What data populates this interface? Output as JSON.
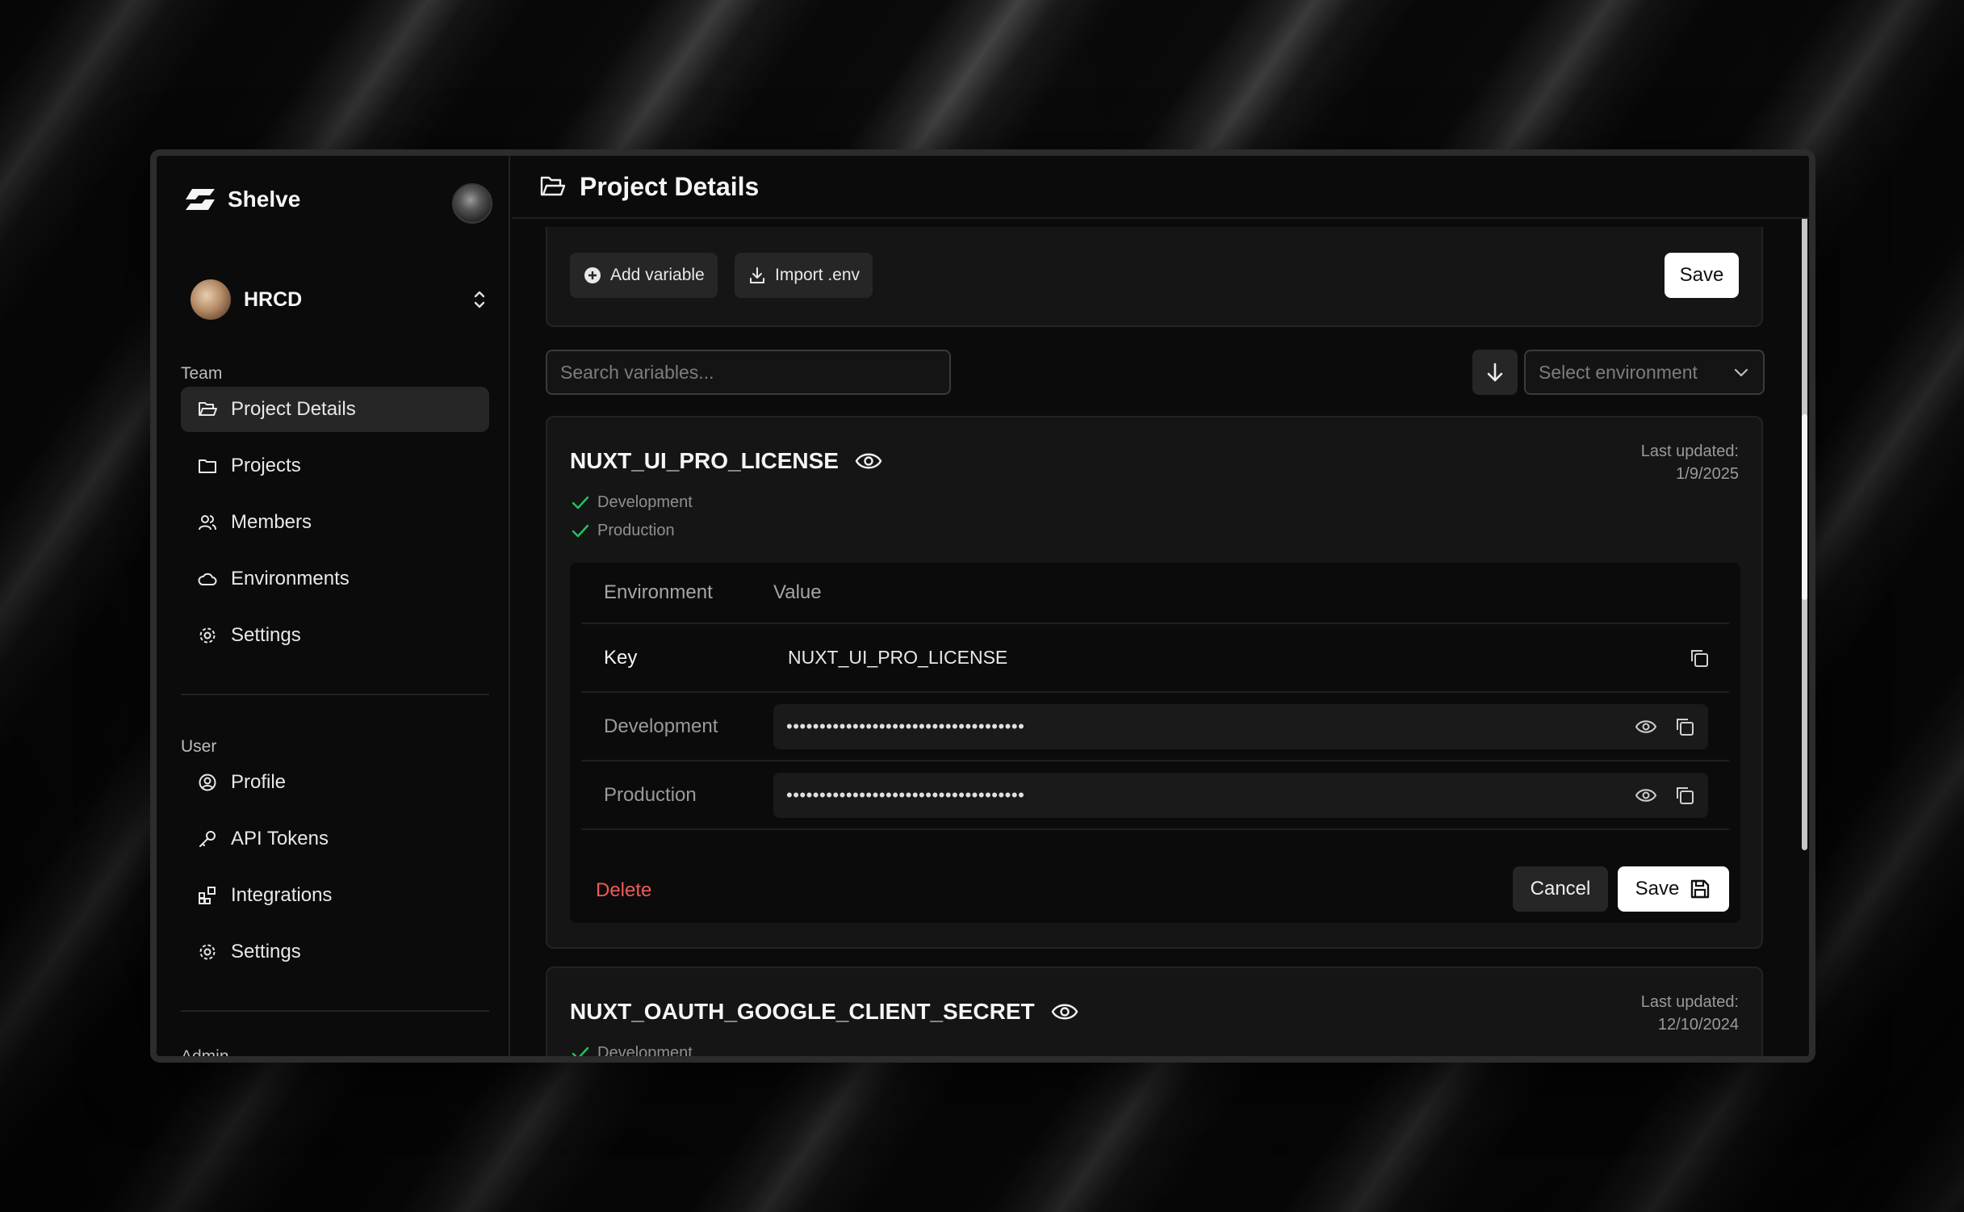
{
  "app": {
    "name": "Shelve"
  },
  "team": {
    "name": "HRCD"
  },
  "sidebar": {
    "team_label": "Team",
    "team_items": [
      {
        "label": "Project Details",
        "icon": "folder-open-icon",
        "active": true
      },
      {
        "label": "Projects",
        "icon": "folder-icon"
      },
      {
        "label": "Members",
        "icon": "users-icon"
      },
      {
        "label": "Environments",
        "icon": "cloud-icon"
      },
      {
        "label": "Settings",
        "icon": "gear-icon"
      }
    ],
    "user_label": "User",
    "user_items": [
      {
        "label": "Profile",
        "icon": "user-circle-icon"
      },
      {
        "label": "API Tokens",
        "icon": "key-icon"
      },
      {
        "label": "Integrations",
        "icon": "grid-plus-icon"
      },
      {
        "label": "Settings",
        "icon": "gear-icon"
      }
    ],
    "admin_label": "Admin"
  },
  "header": {
    "title": "Project Details"
  },
  "toolbar": {
    "add_label": "Add variable",
    "import_label": "Import .env",
    "save_label": "Save"
  },
  "search": {
    "placeholder": "Search variables..."
  },
  "env_select": {
    "placeholder": "Select environment"
  },
  "variables": [
    {
      "key": "NUXT_UI_PRO_LICENSE",
      "last_updated_label": "Last updated:",
      "last_updated": "1/9/2025",
      "envs": [
        "Development",
        "Production"
      ],
      "table": {
        "col_env": "Environment",
        "col_value": "Value",
        "key_label": "Key",
        "key_value": "NUXT_UI_PRO_LICENSE",
        "rows": [
          {
            "env": "Development",
            "value": "••••••••••••••••••••••••••••••••••••"
          },
          {
            "env": "Production",
            "value": "••••••••••••••••••••••••••••••••••••"
          }
        ]
      },
      "delete_label": "Delete",
      "cancel_label": "Cancel",
      "save_label": "Save"
    },
    {
      "key": "NUXT_OAUTH_GOOGLE_CLIENT_SECRET",
      "last_updated_label": "Last updated:",
      "last_updated": "12/10/2024",
      "envs": [
        "Development"
      ]
    }
  ],
  "colors": {
    "accent_check": "#22c55e",
    "danger": "#f05a5a",
    "surface": "#151515"
  }
}
